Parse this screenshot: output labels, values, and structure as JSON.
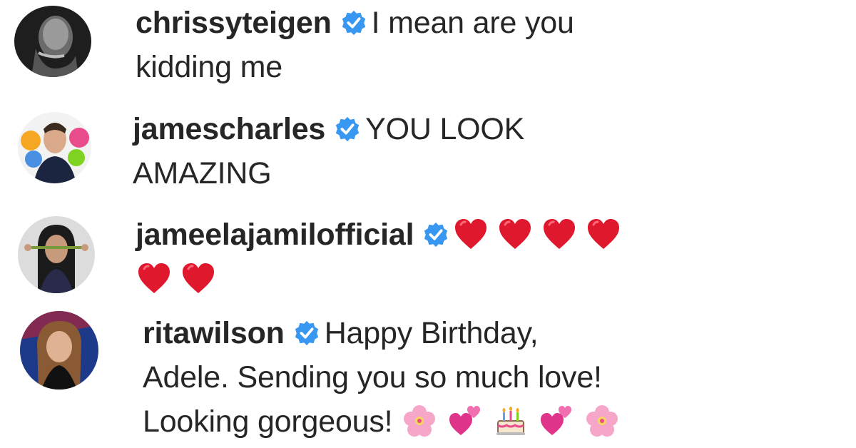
{
  "comments": [
    {
      "username": "chrissyteigen",
      "verified": true,
      "text_line1": "I mean are you",
      "text_line2": "kidding me"
    },
    {
      "username": "jamescharles",
      "verified": true,
      "text_line1": "YOU LOOK",
      "text_line2": "AMAZING"
    },
    {
      "username": "jameelajamilofficial",
      "verified": true,
      "emoji": [
        "red-heart",
        "red-heart",
        "red-heart",
        "red-heart",
        "red-heart",
        "red-heart"
      ]
    },
    {
      "username": "ritawilson",
      "verified": true,
      "text_line1": "Happy Birthday,",
      "text_line2": "Adele. Sending you so much love!",
      "text_line3": "Looking gorgeous!",
      "emoji": [
        "cherry-blossom",
        "two-hearts",
        "birthday-cake",
        "two-hearts",
        "cherry-blossom"
      ]
    }
  ],
  "colors": {
    "text": "#262626",
    "verified_badge": "#3897f0",
    "heart": "#e0182d",
    "background": "#ffffff"
  }
}
